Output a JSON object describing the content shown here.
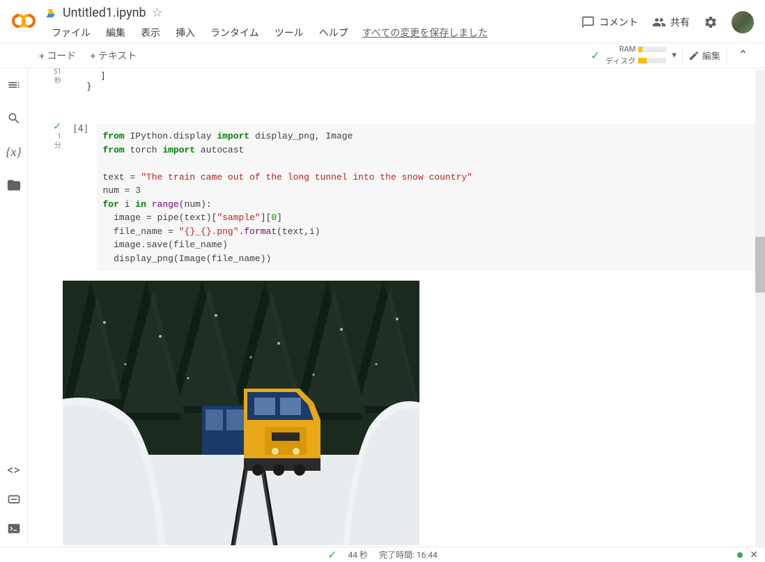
{
  "header": {
    "filename": "Untitled1.ipynb",
    "menus": [
      "ファイル",
      "編集",
      "表示",
      "挿入",
      "ランタイム",
      "ツール",
      "ヘルプ"
    ],
    "saved_msg": "すべての変更を保存しました",
    "comment_label": "コメント",
    "share_label": "共有"
  },
  "toolbar": {
    "code_btn": "+ コード",
    "text_btn": "+ テキスト",
    "ram_label": "RAM",
    "disk_label": "ディスク",
    "edit_label": "編集"
  },
  "cells": {
    "prev_status_time1": "51",
    "prev_status_time2": "秒",
    "prev_brace1": "]",
    "prev_brace2": "}",
    "cell4_num": "[4]",
    "cell4_time1": "1",
    "cell4_time2": "分"
  },
  "code": {
    "l1_kw1": "from",
    "l1_mod": " IPython.display ",
    "l1_kw2": "import",
    "l1_rest": " display_png, Image",
    "l2_kw1": "from",
    "l2_mod": " torch ",
    "l2_kw2": "import",
    "l2_rest": " autocast",
    "l3": "",
    "l4_a": "text = ",
    "l4_str": "\"The train came out of the long tunnel into the snow country\"",
    "l5_a": "num = ",
    "l5_num": "3",
    "l6_kw1": "for",
    "l6_a": " i ",
    "l6_kw2": "in",
    "l6_b": " ",
    "l6_fn": "range",
    "l6_c": "(num):",
    "l7_a": "  image = pipe(text)[",
    "l7_str": "\"sample\"",
    "l7_b": "][",
    "l7_num": "0",
    "l7_c": "]",
    "l8_a": "  file_name = ",
    "l8_str1": "\"{}_{}.png\"",
    "l8_b": ".",
    "l8_fn": "format",
    "l8_c": "(text,i)",
    "l9": "  image.save(file_name)",
    "l10": "  display_png(Image(file_name))"
  },
  "statusbar": {
    "runtime": "44 秒",
    "completed": "完了時間: 16:44"
  }
}
